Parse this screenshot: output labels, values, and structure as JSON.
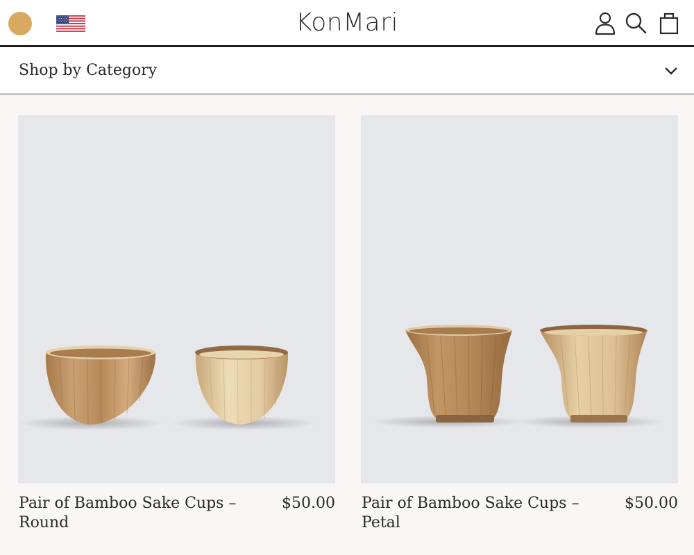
{
  "header": {
    "logo": "KonMari",
    "menu_icon": "menu-circle-icon",
    "flag_icon": "us-flag-icon",
    "account_icon": "user-icon",
    "search_icon": "search-icon",
    "cart_icon": "shopping-bag-icon",
    "accent_color": "#d9a95f"
  },
  "category": {
    "label": "Shop by Category",
    "toggle_icon": "chevron-down-icon"
  },
  "products": [
    {
      "name": "Pair of Bamboo Sake Cups – Round",
      "price": "$50.00",
      "image": "round-bamboo-cups-image"
    },
    {
      "name": "Pair of Bamboo Sake Cups – Petal",
      "price": "$50.00",
      "image": "petal-bamboo-cups-image"
    }
  ]
}
